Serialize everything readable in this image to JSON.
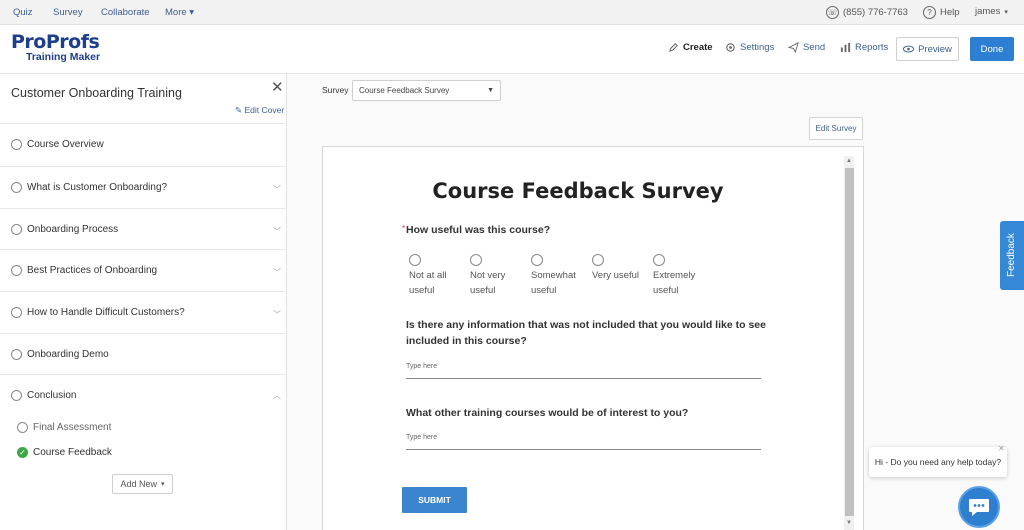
{
  "topnav": {
    "items": [
      "Quiz",
      "Survey",
      "Collaborate",
      "More"
    ],
    "more_caret": "▾",
    "phone": "(855) 776-7763",
    "help": "Help",
    "user": "james"
  },
  "header": {
    "logo_pro1": "Pro",
    "logo_pro2": "Profs",
    "logo_sub": "Training Maker",
    "create": "Create",
    "settings": "Settings",
    "send": "Send",
    "reports": "Reports",
    "preview": "Preview",
    "done": "Done"
  },
  "sidebar": {
    "title": "Customer Onboarding Training",
    "edit_cover": "Edit Cover",
    "items": [
      {
        "label": "Course Overview",
        "has_chevron": false
      },
      {
        "label": "What is Customer Onboarding?",
        "has_chevron": true
      },
      {
        "label": "Onboarding Process",
        "has_chevron": true
      },
      {
        "label": "Best Practices of Onboarding",
        "has_chevron": true
      },
      {
        "label": "How to Handle Difficult Customers?",
        "has_chevron": true
      },
      {
        "label": "Onboarding Demo",
        "has_chevron": false
      },
      {
        "label": "Conclusion",
        "has_chevron": true,
        "expanded": true
      }
    ],
    "sub_items": [
      {
        "label": "Final Assessment",
        "completed": false
      },
      {
        "label": "Course Feedback",
        "completed": true
      }
    ],
    "add_new": "Add New"
  },
  "main": {
    "survey_label": "Survey",
    "survey_selected": "Course Feedback Survey",
    "edit_survey": "Edit Survey"
  },
  "form": {
    "title": "Course Feedback Survey",
    "q1": "How useful was this course?",
    "q1_options": [
      [
        "Not at all",
        "useful"
      ],
      [
        "Not very",
        "useful"
      ],
      [
        "Somewhat",
        "useful"
      ],
      [
        "Very useful",
        ""
      ],
      [
        "Extremely",
        "useful"
      ]
    ],
    "q2_line1": "Is there any information that was not included that you would like to see",
    "q2_line2": "included in this course?",
    "q2_placeholder": "Type here",
    "q3": "What other training courses would be of interest to you?",
    "q3_placeholder": "Type here",
    "submit": "SUBMIT"
  },
  "feedback_tab": "Feedback",
  "chat": {
    "message": "Hi - Do you need any help today?"
  },
  "colors": {
    "brand_blue": "#1d3e8c",
    "accent": "#2d7fd3",
    "success": "#3aa845"
  }
}
